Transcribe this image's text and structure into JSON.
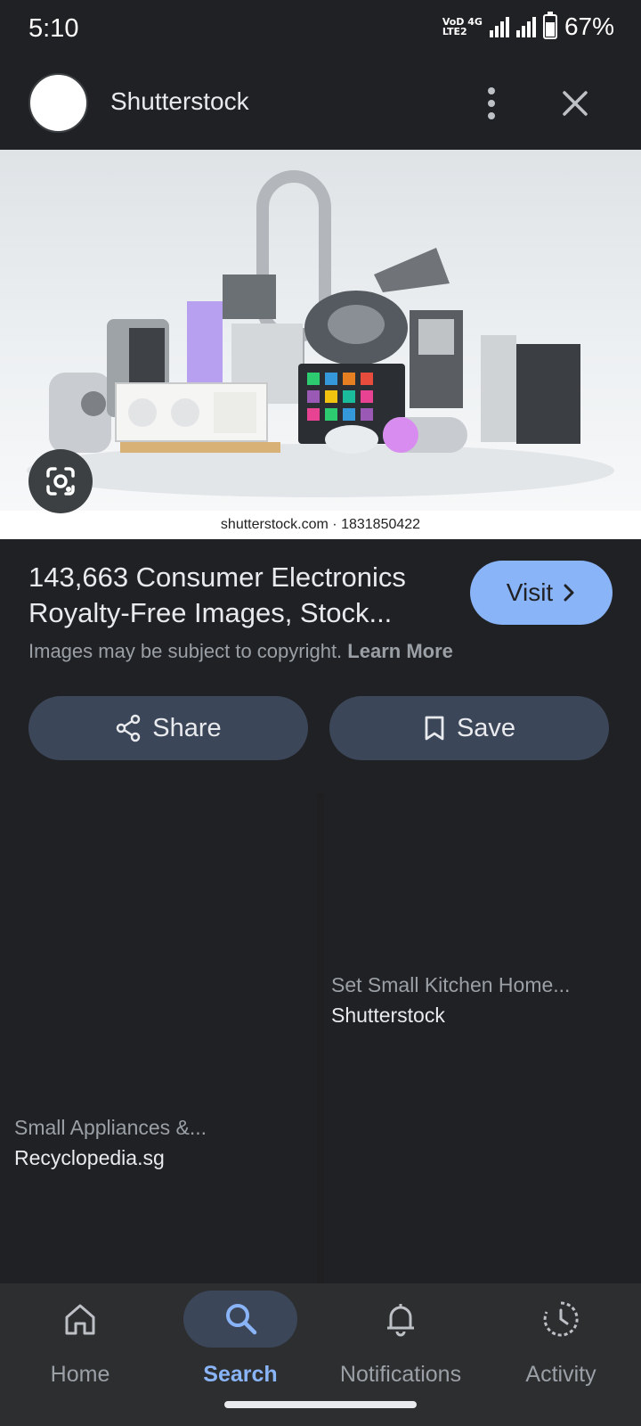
{
  "status_bar": {
    "time": "5:10",
    "network_top": "VoD 4G",
    "network_bottom": "LTE2",
    "battery": "67%",
    "battery_level": 0.67
  },
  "header": {
    "site_name": "Shutterstock"
  },
  "hero": {
    "caption": "shutterstock.com · 1831850422"
  },
  "result": {
    "title": "143,663 Consumer Electronics Royalty-Free Images, Stock...",
    "visit_label": "Visit",
    "copyright_text": "Images may be subject to copyright.",
    "learn_more": "Learn More"
  },
  "actions": {
    "share_label": "Share",
    "save_label": "Save"
  },
  "related": [
    {
      "title": "Small Appliances &...",
      "source": "Recyclopedia.sg"
    },
    {
      "title": "Set Small Kitchen Home...",
      "source": "Shutterstock"
    }
  ],
  "bottom_nav": {
    "items": [
      {
        "label": "Home",
        "icon": "home-icon"
      },
      {
        "label": "Search",
        "icon": "search-icon"
      },
      {
        "label": "Notifications",
        "icon": "bell-icon"
      },
      {
        "label": "Activity",
        "icon": "activity-icon"
      }
    ],
    "active": "Search"
  },
  "colors": {
    "background": "#202124",
    "accent": "#8ab4f8",
    "button_bg": "#3c4659",
    "nav_bg": "#2d2e30"
  }
}
